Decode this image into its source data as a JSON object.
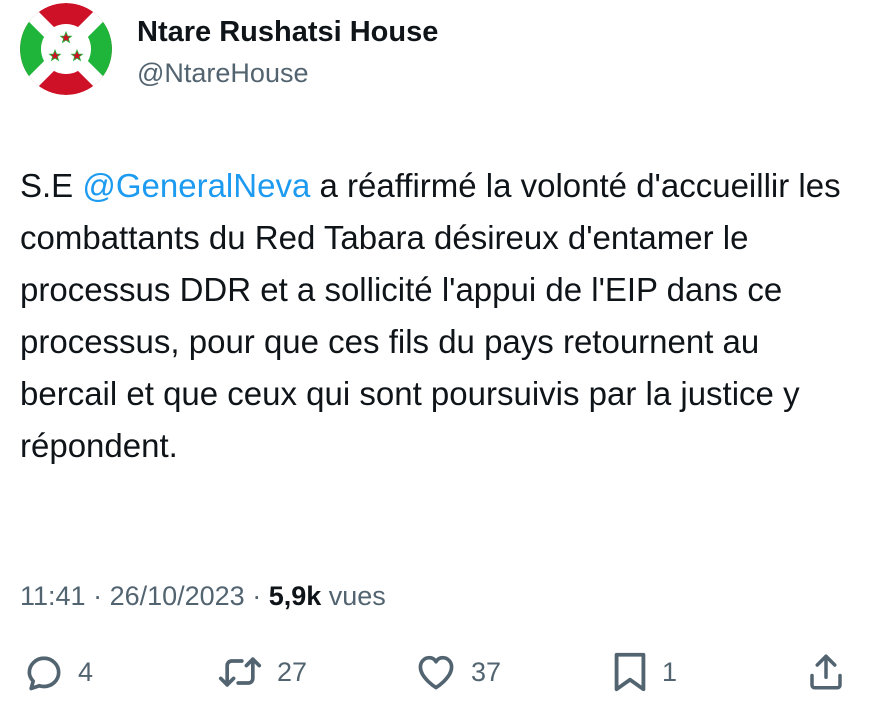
{
  "author": {
    "display_name": "Ntare Rushatsi House",
    "handle": "@NtareHouse"
  },
  "tweet": {
    "text_prefix": "S.E ",
    "mention": "@GeneralNeva",
    "text_suffix": " a réaffirmé la volonté d'accueillir les combattants du Red Tabara désireux d'entamer le processus DDR et a sollicité l'appui de l'EIP dans ce processus, pour que ces fils du pays retournent au bercail et que ceux qui sont poursuivis par la justice y répondent."
  },
  "meta": {
    "time": "11:41",
    "separator": " · ",
    "date": "26/10/2023",
    "separator2": " · ",
    "views_count": "5,9k",
    "views_label": " vues"
  },
  "actions": {
    "replies": "4",
    "reposts": "27",
    "likes": "37",
    "bookmarks": "1"
  },
  "icons": {
    "reply": "speech-bubble-icon",
    "repost": "repost-arrows-icon",
    "like": "heart-icon",
    "bookmark": "bookmark-icon",
    "share": "share-upload-icon"
  },
  "colors": {
    "mention": "#1d9bf0",
    "secondary_text": "#536471",
    "primary_text": "#0f1419",
    "flag_red": "#ce1126",
    "flag_green": "#1eb53a"
  }
}
